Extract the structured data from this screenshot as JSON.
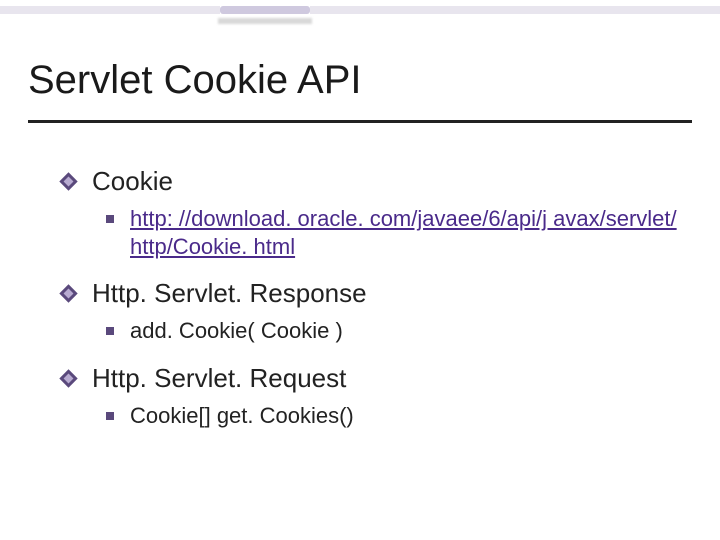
{
  "title": "Servlet Cookie API",
  "items": [
    {
      "label": "Cookie",
      "sub": {
        "is_link": true,
        "text": "http: //download. oracle. com/javaee/6/api/j avax/servlet/http/Cookie. html"
      }
    },
    {
      "label": "Http. Servlet. Response",
      "sub": {
        "is_link": false,
        "text": "add. Cookie( Cookie )"
      }
    },
    {
      "label": "Http. Servlet. Request",
      "sub": {
        "is_link": false,
        "text": "Cookie[] get. Cookies()"
      }
    }
  ]
}
